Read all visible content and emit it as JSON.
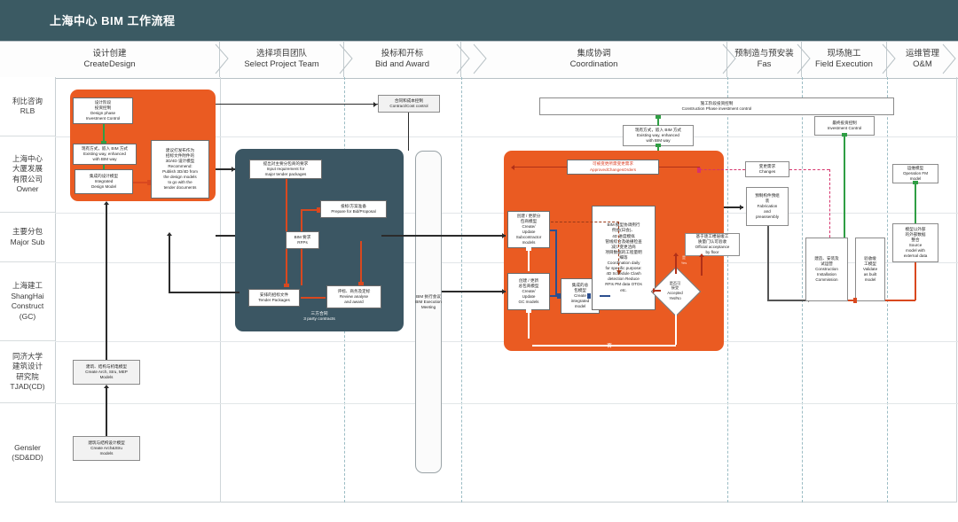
{
  "header": {
    "title": "上海中心 BIM 工作流程"
  },
  "phases": [
    {
      "cn": "设计创建",
      "en": "CreateDesign"
    },
    {
      "cn": "选择项目团队",
      "en": "Select Project Team"
    },
    {
      "cn": "投标和开标",
      "en": "Bid and Award"
    },
    {
      "cn": "集成协调",
      "en": "Coordination"
    },
    {
      "cn": "预制造与预安装",
      "en": "Fas"
    },
    {
      "cn": "现场施工",
      "en": "Field Execution"
    },
    {
      "cn": "运维管理",
      "en": "O&M"
    }
  ],
  "lanes": [
    {
      "cn": "利比咨询",
      "en": "RLB"
    },
    {
      "cn": "上海中心\n大厦发展\n有限公司",
      "en": "Owner"
    },
    {
      "cn": "主要分包",
      "en": "Major Sub"
    },
    {
      "cn": "上海建工",
      "en": "ShangHai\nConstruct\n(GC)"
    },
    {
      "cn": "同济大学\n建筑设计\n研究院",
      "en": "TJAD(CD)"
    },
    {
      "cn": "",
      "en": "Gensler\n(SD&DD)"
    }
  ],
  "nodes": {
    "design_phase_investment": {
      "cn": "设计阶段\n投资控制",
      "en": "Design phase\nInvestment Control"
    },
    "existing_way_design": {
      "cn": "现有方式，嵌入 BIM 方式",
      "en": "Existing way, enhanced\nwith BIM way"
    },
    "integrated_design_model": {
      "cn": "集成的设计模型",
      "en": "Integrated\nDesign Model"
    },
    "publish_3d4d": {
      "cn": "建议打发布作为\n招标文件附件的\n3D/4D 设计模型",
      "en": "Recommend:\nPublish 3D/4D from\nthe design models\nto go with the\ntender documents"
    },
    "contract_cost_control": {
      "cn": "合同和成本控制",
      "en": "Contract/Cost control"
    },
    "construction_phase_investment": {
      "cn": "施工阶段投资控制",
      "en": "Construction Phase investment control"
    },
    "existing_way_coordination": {
      "cn": "现有方式，嵌入 BIM 方式",
      "en": "Existing way, enhanced\nwith BIM way"
    },
    "investment_control": {
      "cn": "最终投资控制",
      "en": "Investment Control"
    },
    "input_requirement": {
      "cn": "提出对主要分包商的要求",
      "en": "Input requirement for\nmajor tender packages"
    },
    "prepare_bid": {
      "cn": "投标/方案准备",
      "en": "Prepare for Bid/Proposal"
    },
    "bim_rfps": {
      "cn": "BIM 要求",
      "en": "RFPs"
    },
    "tender_packages": {
      "cn": "安排的招标文件",
      "en": "Tender Packages"
    },
    "review_award": {
      "cn": "评标、商务及定标",
      "en": "Review analyse\nand award"
    },
    "three_party": {
      "cn": "三方合同",
      "en": "3 party contracts"
    },
    "bim_execution_meeting": {
      "cn": "BIM 执行会议",
      "en": "BIM Execution\nMeeting"
    },
    "subcontractor_models": {
      "cn": "创建 / 更新分\n包商模型",
      "en": "Create/\nUpdate\nSubcontractor\nmodels"
    },
    "gc_models": {
      "cn": "创建 / 更新\n总包商模型",
      "en": "Create/\nUpdate\nGC models"
    },
    "integrated_model": {
      "cn": "集成的总\n包模型",
      "en": "Create\nintegrated\nmodel"
    },
    "coordination_daily": {
      "cn": "BIM 模型协调例行\n例会(日会)、\n4D 进度模拟\n管线综合及碰撞检查\n减少变更洽商\n项目数据的工程量明\n细等",
      "en": "Coordination daily\nfor specific purpose:\n4D Schedule Clash\ndetection Reduce\nRFIs PM data OTOs\netc."
    },
    "approved_changes": {
      "cn": "可被变更所需变更需求",
      "en": "ApprovedChangesOrders"
    },
    "accepted": {
      "cn": "是否可\n接受",
      "en": "Accepted\nYes/No"
    },
    "no_label": {
      "cn": "否",
      "en": ""
    },
    "changes": {
      "cn": "变更需求",
      "en": "Changes"
    },
    "fabrication": {
      "cn": "预制构件预组\n装",
      "en": "Fabrication\nand\npreassembly"
    },
    "official_acceptance": {
      "cn": "基于逐工楼层竣工\n质量门认可验收",
      "en": "Official acceptance\nby floor"
    },
    "construction_installation": {
      "cn": "建造、安装及\n试运营",
      "en": "Construction\nInstallation\nCommission"
    },
    "validate_as_built": {
      "cn": "验收竣\n工模型",
      "en": "Validate\nas built\nmodel"
    },
    "source_model": {
      "cn": "模型以外部\n的外部数据\n整合",
      "en": "Source\nmodel with\nexternal data"
    },
    "operation_fm": {
      "cn": "运维模型",
      "en": "Operation FM\nmodel"
    },
    "create_arch_stru_mep": {
      "cn": "建筑、结构与机电模型",
      "en": "Create Arch, Stru, MEP\nModels"
    },
    "create_arch_stru": {
      "cn": "建筑与结构设计模型",
      "en": "Create Arch&Stru\nmodels"
    }
  },
  "colors": {
    "header_bg": "#3b5a63",
    "orange_panel": "#ea5b22",
    "slate_panel": "#3b5663",
    "accent_red": "#d9481f",
    "accent_green": "#2f9e44",
    "accent_pink": "#d6336c",
    "accent_blue": "#2c4f8f"
  }
}
